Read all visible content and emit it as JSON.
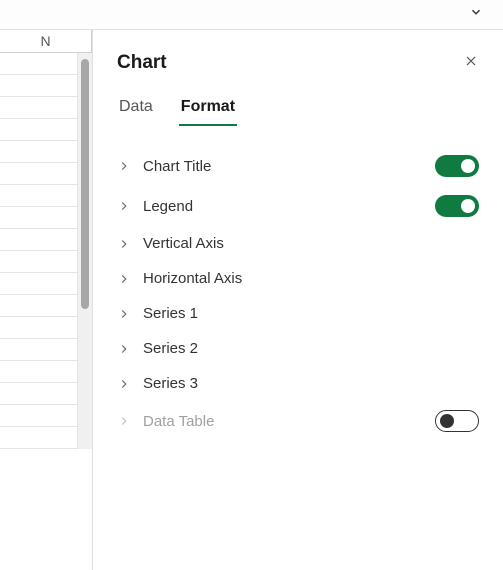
{
  "spreadsheet": {
    "column_header": "N",
    "visible_rows": 18
  },
  "panel": {
    "title": "Chart",
    "tabs": {
      "data": "Data",
      "format": "Format",
      "active": "format"
    },
    "options": [
      {
        "label": "Chart Title",
        "expandable": true,
        "toggle": "on",
        "disabled": false
      },
      {
        "label": "Legend",
        "expandable": true,
        "toggle": "on",
        "disabled": false
      },
      {
        "label": "Vertical Axis",
        "expandable": true,
        "toggle": null,
        "disabled": false
      },
      {
        "label": "Horizontal Axis",
        "expandable": true,
        "toggle": null,
        "disabled": false
      },
      {
        "label": "Series 1",
        "expandable": true,
        "toggle": null,
        "disabled": false
      },
      {
        "label": "Series 2",
        "expandable": true,
        "toggle": null,
        "disabled": false
      },
      {
        "label": "Series 3",
        "expandable": true,
        "toggle": null,
        "disabled": false
      },
      {
        "label": "Data Table",
        "expandable": true,
        "toggle": "off",
        "disabled": true
      }
    ]
  },
  "colors": {
    "accent_green": "#0f7b41"
  }
}
